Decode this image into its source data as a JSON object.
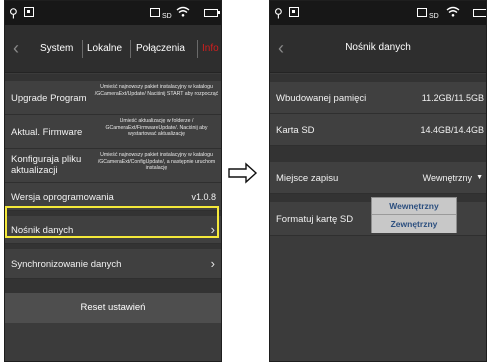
{
  "left": {
    "status_bar": {
      "sd_label": "SD"
    },
    "header": {
      "back_icon": "chevron-left-icon",
      "tabs": [
        "System",
        "Lokalne",
        "Połączenia",
        "Info"
      ],
      "info_color": "#d21e1e"
    },
    "rows": [
      {
        "label": "Upgrade Program",
        "desc": "Umieść najnowszy pakiet instalacyjny w katalogu /GCameraExt/Update/ Naciśnij START aby rozpocząć"
      },
      {
        "label": "Aktual. Firmware",
        "desc": "Umieść aktualizację w folderze / GCameraExt/FirmwareUpdate/. Naciśnij aby wystartować aktualizację"
      },
      {
        "label_line1": "Konfiguraja pliku",
        "label_line2": "aktualizacji",
        "desc": "Umieść najnowszy pakiet instalacyjny w katalogu /GCameraExt/ConfigUpdate/, a następnie uruchom instalację"
      },
      {
        "label": "Wersja oprogramowania",
        "value": "v1.0.8"
      },
      {
        "label": "Nośnik danych",
        "highlighted": true
      },
      {
        "label": "Synchronizowanie danych"
      }
    ],
    "reset_label": "Reset ustawień",
    "highlight_color": "#f5e93a"
  },
  "right": {
    "status_bar": {
      "sd_label": "SD"
    },
    "header": {
      "title": "Nośnik danych",
      "back_icon": "chevron-left-icon"
    },
    "rows": [
      {
        "label": "Wbudowanej pamięci",
        "value": "11.2GB/11.5GB"
      },
      {
        "label": "Karta SD",
        "value": "14.4GB/14.4GB"
      },
      {
        "label": "Miejsce zapisu",
        "value": "Wewnętrzny"
      },
      {
        "label": "Formatuj kartę SD"
      }
    ],
    "dropdown_options": [
      "Wewnętrzny",
      "Zewnętrzny"
    ]
  },
  "arrow_icon": "right-arrow-icon"
}
